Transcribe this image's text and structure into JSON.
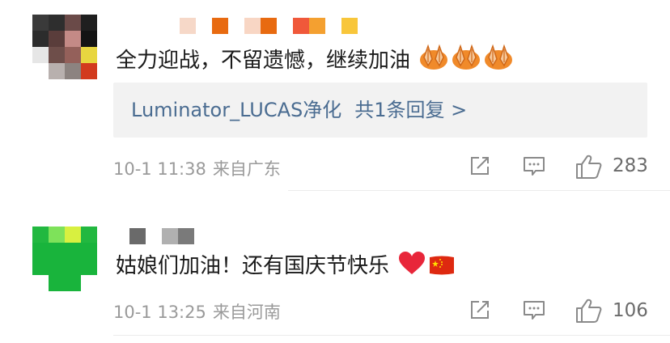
{
  "comments": [
    {
      "text": "全力迎战，不留遗憾，继续加油",
      "emoji_icons": [
        "praying-hands-icon",
        "praying-hands-icon",
        "praying-hands-icon"
      ],
      "reply": {
        "user": "Luminator_LUCAS净化",
        "count_label": "共1条回复 >"
      },
      "date": "10-1 11:38",
      "location": "来自广东",
      "likes": "283"
    },
    {
      "text": "姑娘们加油！还有国庆节快乐",
      "emoji_icons": [
        "red-heart-icon",
        "china-flag-icon"
      ],
      "date": "10-1 13:25",
      "location": "来自河南",
      "likes": "106"
    }
  ],
  "icons": {
    "share": "share-icon",
    "comment": "comment-icon",
    "like": "thumbs-up-icon"
  },
  "colors": {
    "link": "#4a6c91",
    "meta": "#9a9a9a",
    "reply_bg": "#f2f2f2",
    "heart": "#e8263a",
    "flag": "#de2910"
  }
}
